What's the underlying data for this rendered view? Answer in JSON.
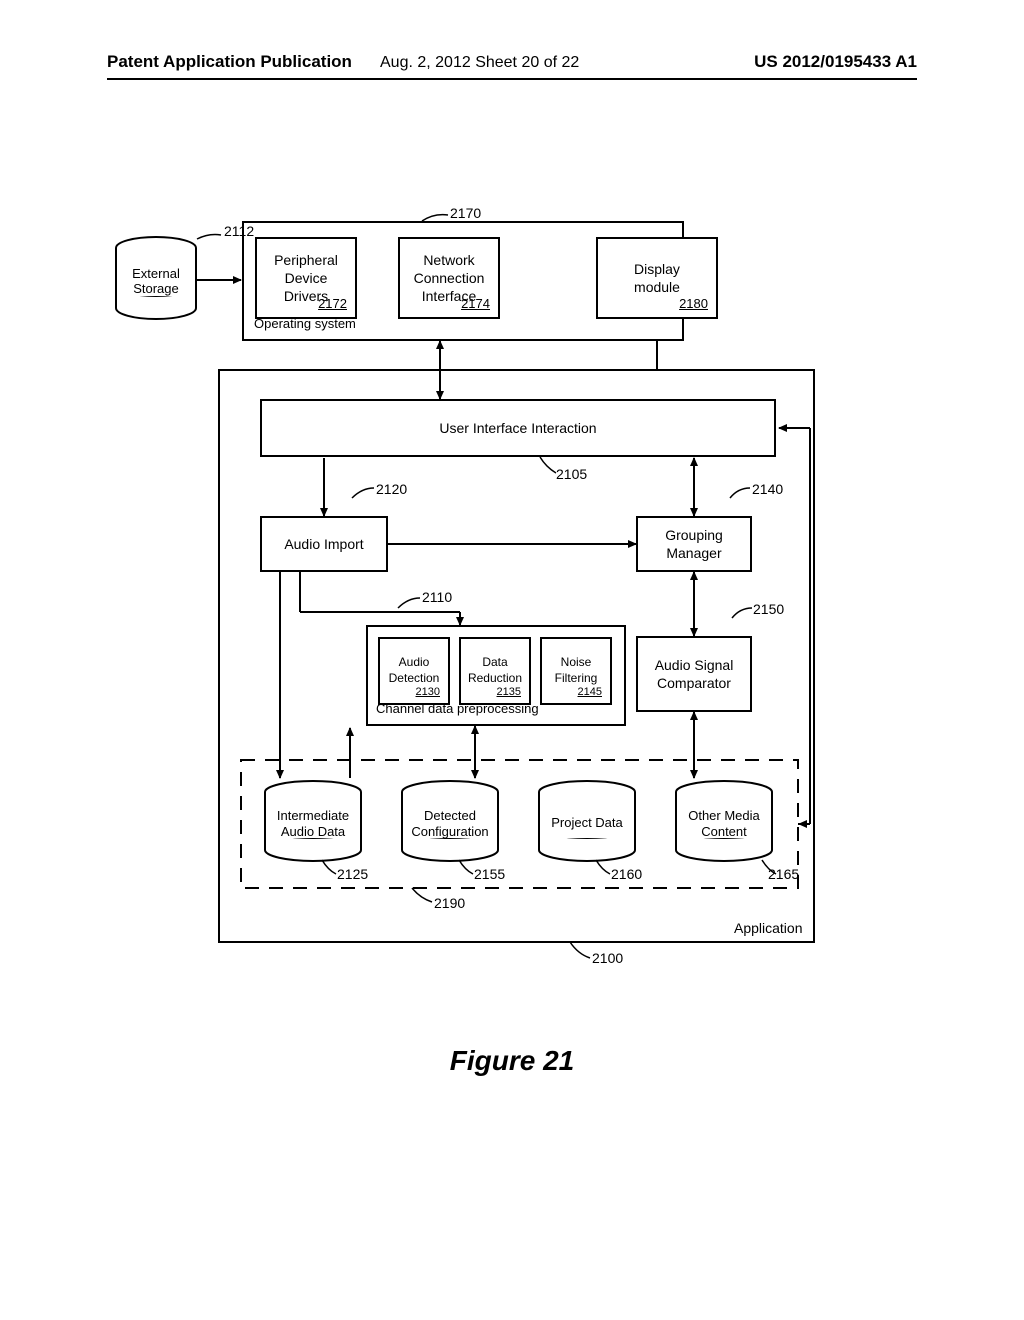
{
  "header": {
    "left": "Patent Application Publication",
    "middle": "Aug. 2, 2012   Sheet 20 of 22",
    "right": "US 2012/0195433 A1"
  },
  "figure_title": "Figure 21",
  "labels": {
    "external_storage": "External\nStorage",
    "peripheral_drivers": "Peripheral\nDevice\nDrivers",
    "network_interface": "Network\nConnection\nInterface",
    "display_module": "Display\nmodule",
    "operating_system": "Operating system",
    "ui_interaction": "User Interface Interaction",
    "audio_import": "Audio Import",
    "grouping_manager": "Grouping\nManager",
    "audio_detection": "Audio\nDetection",
    "data_reduction": "Data\nReduction",
    "noise_filtering": "Noise\nFiltering",
    "audio_signal_comparator": "Audio Signal\nComparator",
    "channel_preprocessing": "Channel data preprocessing",
    "intermediate_audio": "Intermediate\nAudio Data",
    "detected_config": "Detected\nConfiguration",
    "project_data": "Project Data",
    "other_media": "Other Media\nContent",
    "application": "Application"
  },
  "refs": {
    "r2112": "2112",
    "r2170": "2170",
    "r2172": "2172",
    "r2174": "2174",
    "r2180": "2180",
    "r2105": "2105",
    "r2120": "2120",
    "r2140": "2140",
    "r2110": "2110",
    "r2130": "2130",
    "r2135": "2135",
    "r2145": "2145",
    "r2150": "2150",
    "r2190": "2190",
    "r2125": "2125",
    "r2155": "2155",
    "r2160": "2160",
    "r2165": "2165",
    "r2100": "2100"
  }
}
